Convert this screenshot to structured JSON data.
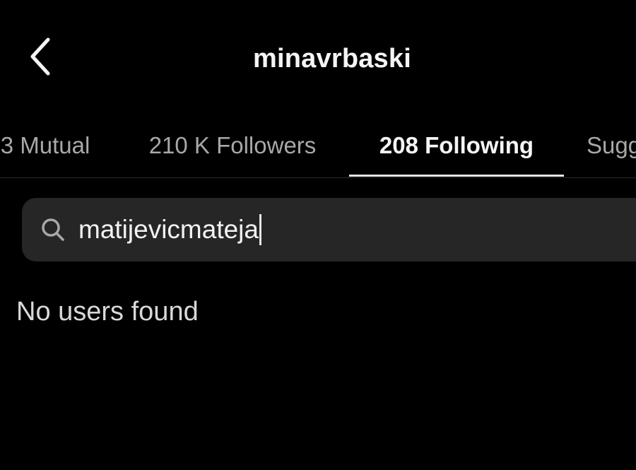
{
  "header": {
    "back_icon": "chevron-left-icon",
    "username": "minavrbaski"
  },
  "tabs": [
    {
      "label": "3 Mutual",
      "active": false
    },
    {
      "label": "210 K Followers",
      "active": false
    },
    {
      "label": "208 Following",
      "active": true
    },
    {
      "label": "Suggested",
      "active": false
    }
  ],
  "search": {
    "icon": "search-icon",
    "value": "matijevicmateja"
  },
  "results": {
    "empty_message": "No users found"
  },
  "colors": {
    "background": "#000000",
    "search_bar": "#262626",
    "inactive_tab": "#a8a8a8",
    "active_tab": "#f5f5f5"
  }
}
